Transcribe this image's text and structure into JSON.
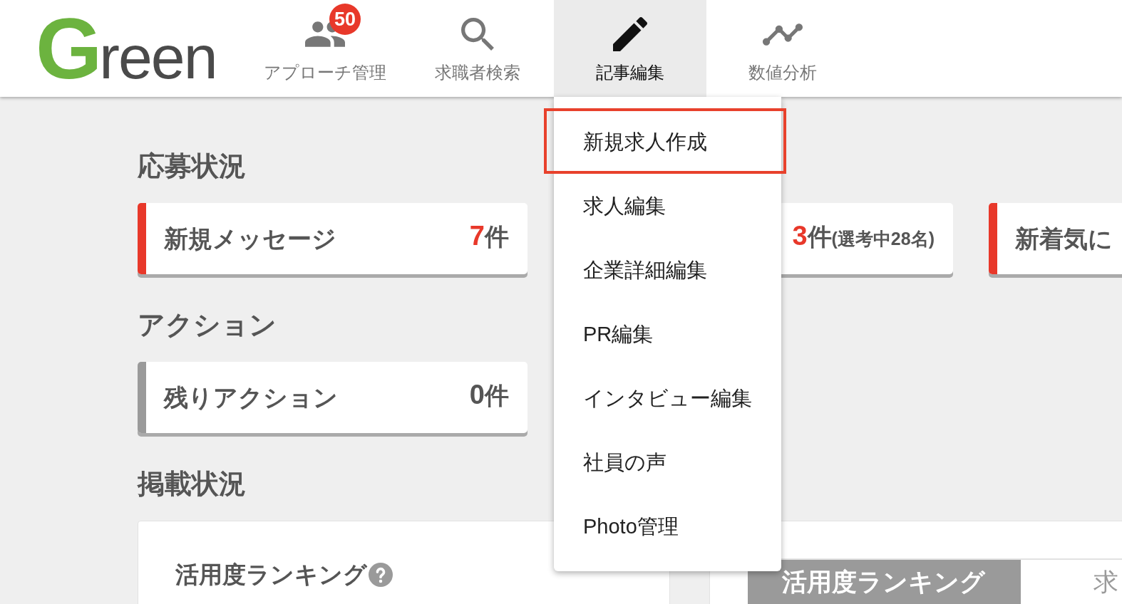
{
  "header": {
    "logo": {
      "initial": "G",
      "rest": "reen"
    },
    "nav": [
      {
        "label": "アプローチ管理",
        "badge": "50",
        "selected": false
      },
      {
        "label": "求職者検索",
        "selected": false
      },
      {
        "label": "記事編集",
        "selected": true
      },
      {
        "label": "数値分析",
        "selected": false
      }
    ]
  },
  "menu": {
    "items": [
      {
        "label": "新規求人作成",
        "highlighted": true
      },
      {
        "label": "求人編集",
        "highlighted": false
      },
      {
        "label": "企業詳細編集",
        "highlighted": false
      },
      {
        "label": "PR編集",
        "highlighted": false
      },
      {
        "label": "インタビュー編集",
        "highlighted": false
      },
      {
        "label": "社員の声",
        "highlighted": false
      },
      {
        "label": "Photo管理",
        "highlighted": false
      }
    ]
  },
  "sections": [
    {
      "heading": "応募状況",
      "cards": [
        {
          "label": "新規メッセージ",
          "count": "7",
          "unit": "件",
          "alert": true
        },
        {
          "count": "3",
          "unit": "件",
          "note": "(選考中28名)",
          "alert": true
        },
        {
          "label": "新着気に",
          "alert": true
        }
      ]
    },
    {
      "heading": "アクション",
      "cards": [
        {
          "label": "残りアクション",
          "count": "0",
          "unit": "件",
          "alert": false
        }
      ]
    }
  ],
  "posting": {
    "heading": "掲載状況",
    "panel_title": "活用度ランキング",
    "tabs": [
      {
        "label": "活用度ランキング",
        "selected": true
      },
      {
        "label": "求",
        "selected": false
      }
    ]
  }
}
